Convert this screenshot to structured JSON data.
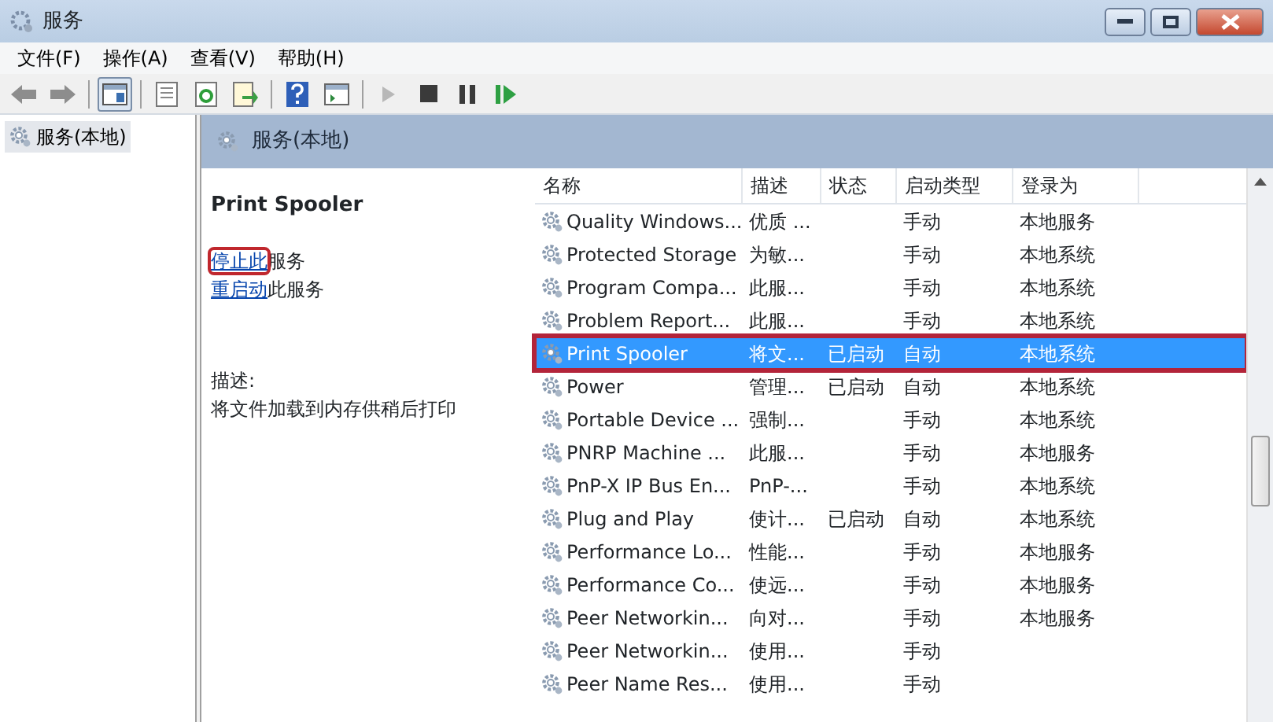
{
  "window": {
    "title": "服务"
  },
  "menu": [
    "文件(F)",
    "操作(A)",
    "查看(V)",
    "帮助(H)"
  ],
  "toolbar": [
    {
      "kind": "back",
      "disabled": false
    },
    {
      "kind": "forward",
      "disabled": false
    },
    {
      "kind": "sep"
    },
    {
      "kind": "console",
      "selected": true
    },
    {
      "kind": "sep"
    },
    {
      "kind": "properties",
      "selected": false
    },
    {
      "kind": "refresh",
      "selected": false
    },
    {
      "kind": "export",
      "selected": false
    },
    {
      "kind": "sep"
    },
    {
      "kind": "help",
      "selected": false
    },
    {
      "kind": "view",
      "selected": false
    },
    {
      "kind": "sep"
    },
    {
      "kind": "start",
      "disabled": true
    },
    {
      "kind": "stop",
      "disabled": false
    },
    {
      "kind": "pause",
      "disabled": false
    },
    {
      "kind": "resume",
      "disabled": false
    }
  ],
  "tree": {
    "items": [
      {
        "label": "服务(本地)",
        "selected": true
      }
    ]
  },
  "panel": {
    "title": "服务(本地)",
    "details": {
      "service_name": "Print Spooler",
      "actions": [
        {
          "link": "停止此",
          "text": "服务",
          "highlighted": true
        },
        {
          "link": "重启动",
          "text": "此服务",
          "highlighted": false
        }
      ],
      "description_label": "描述:",
      "description": "将文件加载到内存供稍后打印"
    },
    "table": {
      "columns": [
        "名称",
        "描述",
        "状态",
        "启动类型",
        "登录为"
      ],
      "rows": [
        {
          "cells": [
            "Quality Windows...",
            "优质 ...",
            "",
            "手动",
            "本地服务"
          ],
          "selected": false,
          "highlighted": false
        },
        {
          "cells": [
            "Protected Storage",
            "为敏...",
            "",
            "手动",
            "本地系统"
          ],
          "selected": false,
          "highlighted": false
        },
        {
          "cells": [
            "Program Compa...",
            "此服...",
            "",
            "手动",
            "本地系统"
          ],
          "selected": false,
          "highlighted": false
        },
        {
          "cells": [
            "Problem Report...",
            "此服...",
            "",
            "手动",
            "本地系统"
          ],
          "selected": false,
          "highlighted": false
        },
        {
          "cells": [
            "Print Spooler",
            "将文...",
            "已启动",
            "自动",
            "本地系统"
          ],
          "selected": true,
          "highlighted": true
        },
        {
          "cells": [
            "Power",
            "管理...",
            "已启动",
            "自动",
            "本地系统"
          ],
          "selected": false,
          "highlighted": false
        },
        {
          "cells": [
            "Portable Device ...",
            "强制...",
            "",
            "手动",
            "本地系统"
          ],
          "selected": false,
          "highlighted": false
        },
        {
          "cells": [
            "PNRP Machine ...",
            "此服...",
            "",
            "手动",
            "本地服务"
          ],
          "selected": false,
          "highlighted": false
        },
        {
          "cells": [
            "PnP-X IP Bus En...",
            "PnP-...",
            "",
            "手动",
            "本地系统"
          ],
          "selected": false,
          "highlighted": false
        },
        {
          "cells": [
            "Plug and Play",
            "使计...",
            "已启动",
            "自动",
            "本地系统"
          ],
          "selected": false,
          "highlighted": false
        },
        {
          "cells": [
            "Performance Lo...",
            "性能...",
            "",
            "手动",
            "本地服务"
          ],
          "selected": false,
          "highlighted": false
        },
        {
          "cells": [
            "Performance Co...",
            "使远...",
            "",
            "手动",
            "本地服务"
          ],
          "selected": false,
          "highlighted": false
        },
        {
          "cells": [
            "Peer Networkin...",
            "向对...",
            "",
            "手动",
            "本地服务"
          ],
          "selected": false,
          "highlighted": false
        },
        {
          "cells": [
            "Peer Networkin...",
            "使用...",
            "",
            "手动",
            ""
          ],
          "selected": false,
          "highlighted": false
        },
        {
          "cells": [
            "Peer Name Res...",
            "使用...",
            "",
            "手动",
            ""
          ],
          "selected": false,
          "highlighted": false
        }
      ]
    }
  }
}
